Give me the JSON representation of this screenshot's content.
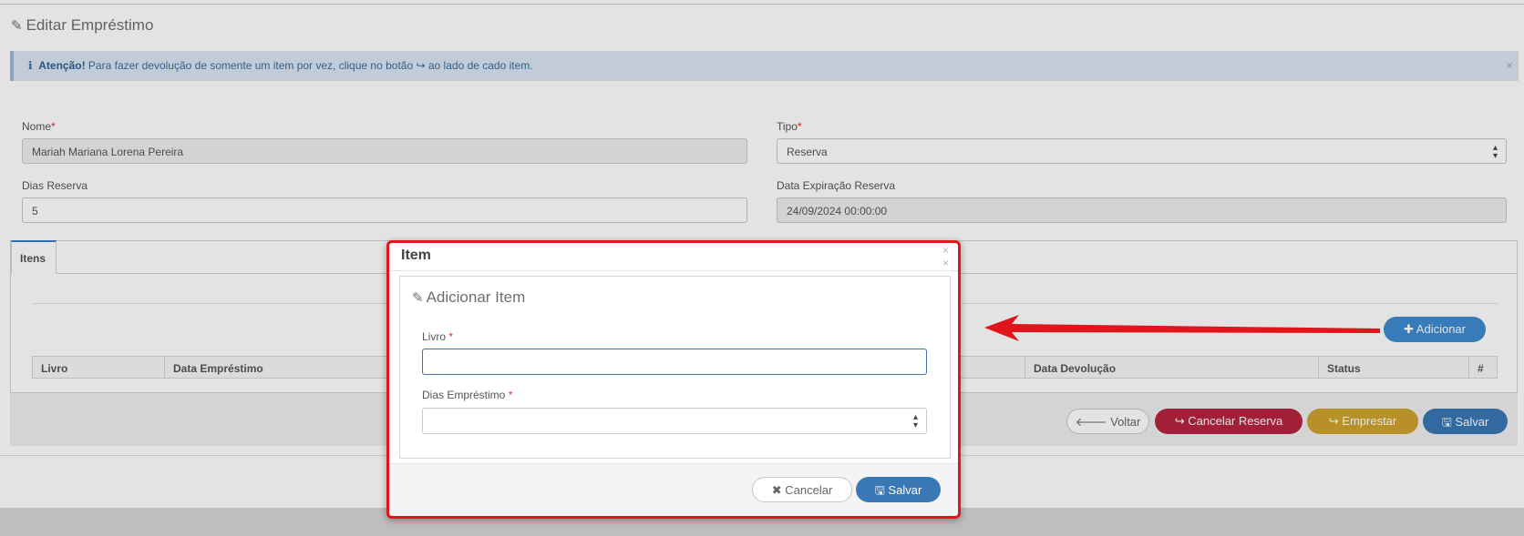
{
  "page": {
    "title": "Editar Empréstimo",
    "title_icon": "edit-icon"
  },
  "alert": {
    "info_icon": "ℹ",
    "strong": "Atenção!",
    "text_before": "Para fazer devolução de somente um item por vez, clique no botão",
    "share_icon": "↪",
    "text_after": "ao lado de cado item.",
    "close": "×"
  },
  "form": {
    "nome_label": "Nome",
    "nome_value": "Mariah Mariana Lorena Pereira",
    "tipo_label": "Tipo",
    "tipo_value": "Reserva",
    "dias_reserva_label": "Dias Reserva",
    "dias_reserva_value": "5",
    "data_expiracao_label": "Data Expiração Reserva",
    "data_expiracao_value": "24/09/2024 00:00:00",
    "required_mark": "*"
  },
  "tabs": {
    "items": [
      "Itens"
    ]
  },
  "table": {
    "columns": [
      "Livro",
      "Data Empréstimo",
      "",
      "Data Devolução",
      "Status",
      "#"
    ]
  },
  "buttons": {
    "adicionar": "Adicionar",
    "voltar": "Voltar",
    "cancelar_reserva": "Cancelar Reserva",
    "emprestar": "Emprestar",
    "salvar": "Salvar"
  },
  "modal": {
    "title": "Item",
    "close_top": "×",
    "close_second": "×",
    "panel_title": "Adicionar Item",
    "livro_label": "Livro",
    "livro_value": "",
    "dias_emprestimo_label": "Dias Empréstimo",
    "dias_emprestimo_value": "",
    "cancel_label": "Cancelar",
    "save_label": "Salvar"
  },
  "colors": {
    "primary": "#3a77b5",
    "danger": "#b7243e",
    "warning": "#cfa22e",
    "highlight_border": "#e0161c",
    "annotation_arrow": "#e0161c"
  }
}
